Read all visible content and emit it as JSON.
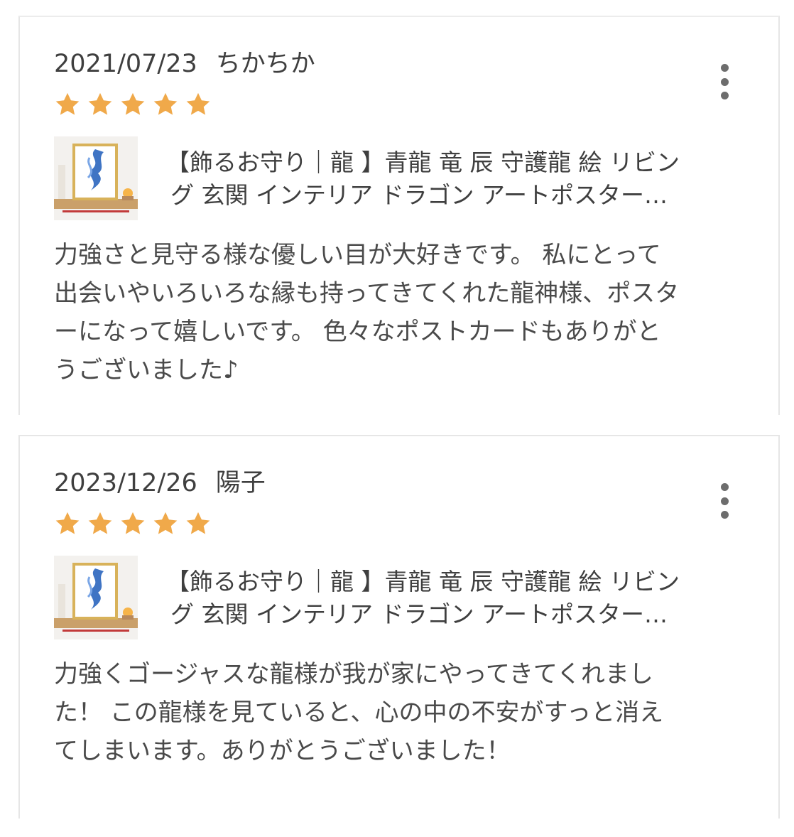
{
  "reviews": [
    {
      "date": "2021/07/23",
      "author": "ちかちか",
      "rating": 5,
      "product_title_line1": "【飾るお守り｜龍 】青龍 竜 辰 守護龍 絵 リビン",
      "product_title_line2": "グ 玄関 インテリア ドラゴン アートポスター…",
      "body_lines": [
        "力強さと見守る様な優しい目が大好きです。 私にとって",
        "出会いやいろいろな縁も持ってきてくれた龍神様、ポスタ",
        "ーになって嬉しいです。 色々なポストカードもありがと",
        "うございました♪"
      ]
    },
    {
      "date": "2023/12/26",
      "author": "陽子",
      "rating": 5,
      "product_title_line1": "【飾るお守り｜龍 】青龍 竜 辰 守護龍 絵 リビン",
      "product_title_line2": "グ 玄関 インテリア ドラゴン アートポスター…",
      "body_lines": [
        "力強くゴージャスな龍様が我が家にやってきてくれまし",
        "た！ この龍様を見ていると、心の中の不安がすっと消え",
        "てしまいます。ありがとうございました！"
      ]
    }
  ],
  "icons": {
    "star": "star-icon",
    "more": "more-vertical-icon"
  },
  "colors": {
    "star": "#f0a94a",
    "text": "#4a4a4a",
    "border": "#e6e6e6"
  }
}
